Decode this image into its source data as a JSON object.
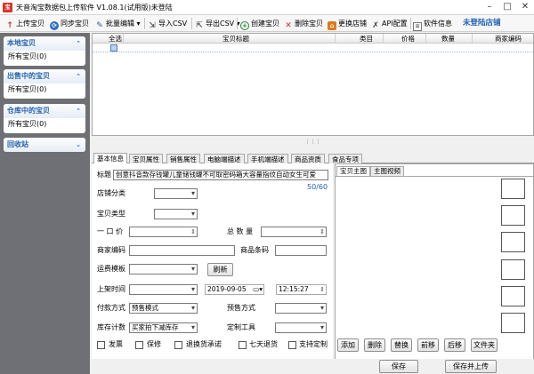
{
  "window": {
    "icon_text": "宝",
    "title": "天音淘宝数据包上传软件 V1.08.1(试用版)未登陆"
  },
  "toolbar": {
    "upload": "上传宝贝",
    "sync": "同步宝贝",
    "batch_edit": "批量编辑",
    "import_csv": "导入CSV",
    "export_csv": "导出CSV",
    "create": "创建宝贝",
    "delete": "删除宝贝",
    "switch_shop": "更换店铺",
    "api_config": "API配置",
    "software_info": "软件信息",
    "login_status": "未登陆店铺"
  },
  "sidebar": {
    "panels": [
      {
        "title": "本地宝贝",
        "item": "所有宝贝(0)"
      },
      {
        "title": "出售中的宝贝",
        "item": "所有宝贝(0)"
      },
      {
        "title": "仓库中的宝贝",
        "item": "所有宝贝(0)"
      },
      {
        "title": "回收站"
      }
    ]
  },
  "grid": {
    "columns": [
      "全选",
      "宝贝标题",
      "类目",
      "价格",
      "数量",
      "商家编码"
    ]
  },
  "tabs": [
    "基本信息",
    "宝贝属性",
    "销售属性",
    "电脑端描述",
    "手机端描述",
    "商品资质",
    "食品专项"
  ],
  "form": {
    "title_label": "标题",
    "title_value": "创意抖音款存钱罐儿童储钱罐不可取密码箱大容量指纹自动女生可爱",
    "title_count": "50/60",
    "shop_category_label": "店铺分类",
    "product_type_label": "宝贝类型",
    "price_label": "一 口 价",
    "total_qty_label": "总 数 量",
    "merchant_code_label": "商家编码",
    "barcode_label": "商品条码",
    "shipping_template_label": "运费模板",
    "refresh_button": "刷新",
    "list_time_label": "上架时间",
    "list_date": "2019-09-05",
    "list_time": "12:15:27",
    "pay_method_label": "付款方式",
    "pay_method_value": "预售模式",
    "presale_method_label": "预售方式",
    "stock_count_label": "库存计数",
    "stock_count_value": "买家拍下减库存",
    "custom_tool_label": "定制工具",
    "checkboxes": [
      "发票",
      "保修",
      "退换货承诺",
      "七天退货",
      "支持定制"
    ]
  },
  "image_panel": {
    "tabs": [
      "宝贝主图",
      "主图视频"
    ],
    "buttons": [
      "添加",
      "删除",
      "替换",
      "前移",
      "后移",
      "文件夹"
    ]
  },
  "bottom": {
    "save_button": "保存",
    "save_upload_button": "保存并上传"
  }
}
